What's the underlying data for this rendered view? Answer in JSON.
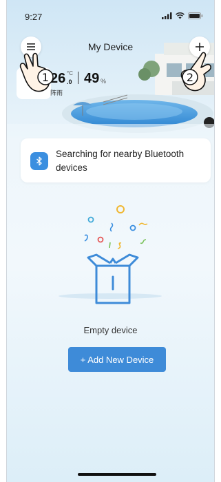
{
  "status_bar": {
    "time": "9:27",
    "icons": [
      "signal-icon",
      "wifi-icon",
      "battery-icon"
    ]
  },
  "header": {
    "title": "My Device",
    "menu_icon": "menu-icon",
    "add_icon": "plus-icon"
  },
  "weather": {
    "temperature": "26",
    "temp_unit": "°C",
    "temp_decimal": ".0",
    "humidity": "49",
    "humidity_unit": "%",
    "description": "阵雨"
  },
  "bluetooth_banner": {
    "icon": "bluetooth-icon",
    "text": "Searching for nearby Bluetooth devices"
  },
  "empty_state": {
    "label": "Empty device",
    "button_label": "+ Add New Device"
  },
  "callouts": [
    "1",
    "2"
  ],
  "colors": {
    "accent": "#3e8bd8",
    "bluetooth": "#3b8fe0",
    "background": "#eaf4fa"
  }
}
